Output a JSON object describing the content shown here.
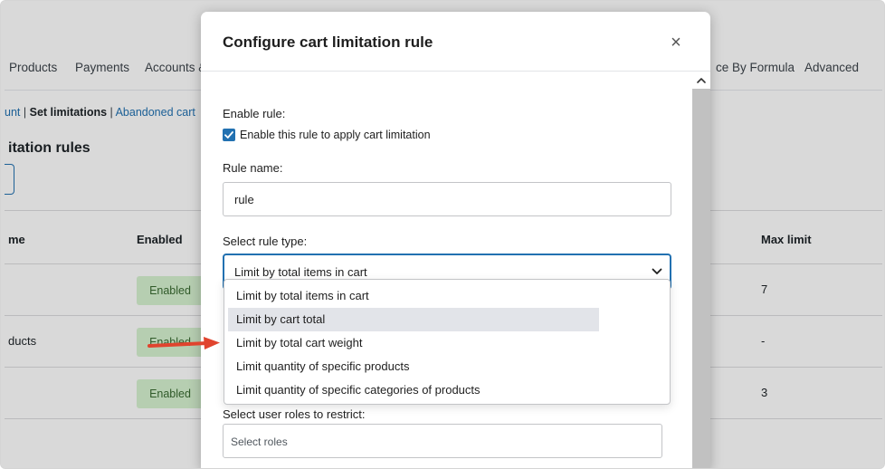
{
  "background": {
    "nav_tabs": [
      "Products",
      "Payments",
      "Accounts &",
      "ce By Formula",
      "Advanced"
    ],
    "subnav": {
      "prev_link": "unt",
      "separator": "|",
      "current": "Set limitations",
      "next_link": "Abandoned cart"
    },
    "section_title": "itation rules",
    "table": {
      "headers": [
        "me",
        "Enabled",
        "Max limit"
      ],
      "rows": [
        {
          "name": "",
          "status": "Enabled",
          "max": "7"
        },
        {
          "name": "ducts",
          "status": "Enabled",
          "max": "-"
        },
        {
          "name": "",
          "status": "Enabled",
          "max": "3"
        }
      ]
    }
  },
  "modal": {
    "title": "Configure cart limitation rule",
    "close_icon": "×",
    "enable_label": "Enable rule:",
    "enable_checkbox_label": "Enable this rule to apply cart limitation",
    "enable_checked": true,
    "rule_name_label": "Rule name:",
    "rule_name_value": "rule",
    "rule_type_label": "Select rule type:",
    "rule_type_selected": "Limit by total items in cart",
    "rule_type_options": [
      "Limit by total items in cart",
      "Limit by cart total",
      "Limit by total cart weight",
      "Limit quantity of specific products",
      "Limit quantity of specific categories of products"
    ],
    "hovered_option_index": 1,
    "user_roles_label": "Select user roles to restrict:",
    "user_roles_placeholder": "Select roles"
  },
  "colors": {
    "accent": "#2271b1",
    "badge_bg": "#d6f2d0",
    "annotation_arrow": "#e0442e"
  }
}
